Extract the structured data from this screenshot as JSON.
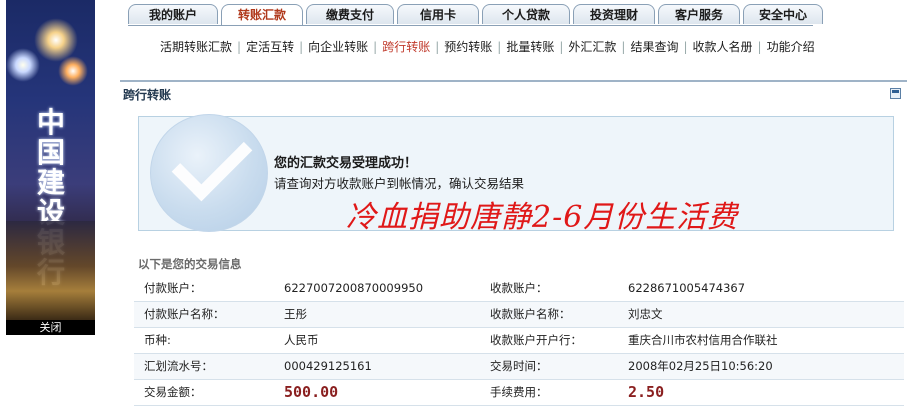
{
  "banner": {
    "bank_name": "中国建设银行",
    "close_label": "关闭"
  },
  "tabs": [
    "我的账户",
    "转账汇款",
    "缴费支付",
    "信用卡",
    "个人贷款",
    "投资理财",
    "客户服务",
    "安全中心"
  ],
  "active_tab": "转账汇款",
  "subnav": [
    "活期转账汇款",
    "定活互转",
    "向企业转账",
    "跨行转账",
    "预约转账",
    "批量转账",
    "外汇汇款",
    "结果查询",
    "收款人名册",
    "功能介绍"
  ],
  "active_subnav": "跨行转账",
  "section": {
    "title": "跨行转账"
  },
  "success": {
    "title": "您的汇款交易受理成功！",
    "message": "请查询对方收款账户到帐情况，确认交易结果"
  },
  "overlay_text": "冷血捐助唐静2-6月份生活费",
  "info": {
    "title": "以下是您的交易信息",
    "rows": [
      {
        "label1": "付款账户：",
        "value1": "6227007200870009950",
        "label2": "收款账户：",
        "value2": "6228671005474367"
      },
      {
        "label1": "付款账户名称：",
        "value1": "王彤",
        "label2": "收款账户名称：",
        "value2": "刘忠文"
      },
      {
        "label1": "币种:",
        "value1": "人民币",
        "label2": "收款账户开户行：",
        "value2": "重庆合川市农村信用合作联社"
      },
      {
        "label1": "汇划流水号：",
        "value1": "000429125161",
        "label2": "交易时间：",
        "value2": "2008年02月25日10:56:20"
      },
      {
        "label1": "交易金额：",
        "value1": "500.00",
        "label2": "手续费用：",
        "value2": "2.50"
      }
    ]
  },
  "colors": {
    "active_tab": "#b0391c",
    "active_subnav": "#c0392b",
    "overlay": "#e01818",
    "money": "#8a1f1f"
  }
}
